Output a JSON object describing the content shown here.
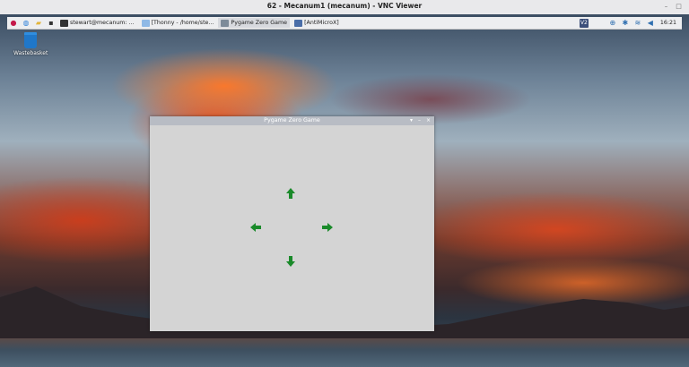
{
  "vnc": {
    "title": "62 - Mecanum1 (mecanum) - VNC Viewer"
  },
  "taskbar": {
    "tasks": [
      {
        "label": "stewart@mecanum: ...",
        "icon": "terminal-icon"
      },
      {
        "label": "[Thonny - /home/ste...",
        "icon": "thonny-icon"
      },
      {
        "label": "Pygame Zero Game",
        "icon": "pygame-icon"
      },
      {
        "label": "[AntiMicroX]",
        "icon": "gamepad-icon"
      }
    ],
    "clock": "16:21",
    "tray_badge": "V2"
  },
  "desktop": {
    "wastebasket_label": "Wastebasket"
  },
  "pygame_window": {
    "title": "Pygame Zero Game",
    "arrows": [
      "up",
      "left",
      "right",
      "down"
    ],
    "arrow_color": "#1a8a2a"
  }
}
